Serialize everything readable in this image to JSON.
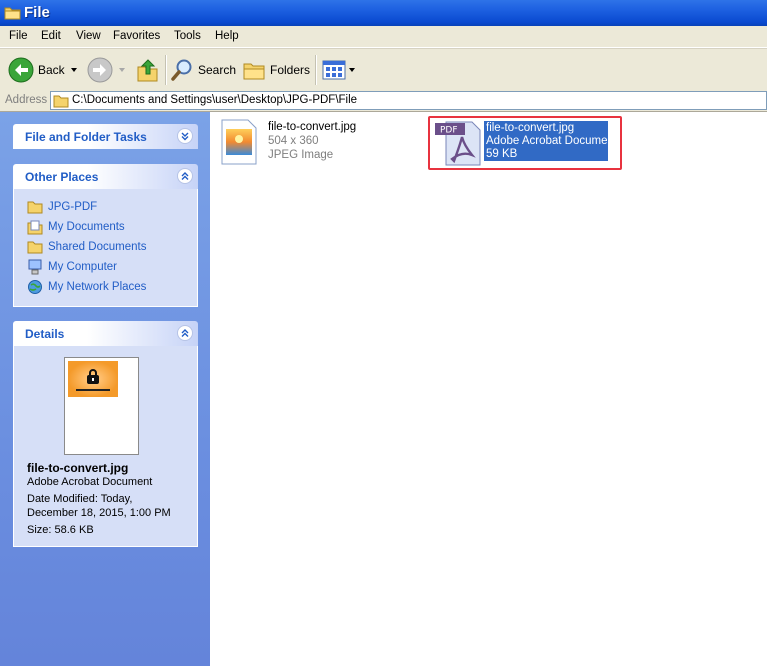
{
  "window": {
    "title": "File"
  },
  "menu": {
    "items": [
      "File",
      "Edit",
      "View",
      "Favorites",
      "Tools",
      "Help"
    ]
  },
  "toolbar": {
    "back_label": "Back",
    "search_label": "Search",
    "folders_label": "Folders"
  },
  "address": {
    "label": "Address",
    "path": "C:\\Documents and Settings\\user\\Desktop\\JPG-PDF\\File"
  },
  "sidebar": {
    "file_tasks": {
      "title": "File and Folder Tasks"
    },
    "other_places": {
      "title": "Other Places",
      "items": [
        "JPG-PDF",
        "My Documents",
        "Shared Documents",
        "My Computer",
        "My Network Places"
      ]
    },
    "details": {
      "title": "Details",
      "filename": "file-to-convert.jpg",
      "type": "Adobe Acrobat Document",
      "modified_line1": "Date Modified: Today,",
      "modified_line2": "December 18, 2015, 1:00 PM",
      "size": "Size: 58.6 KB"
    }
  },
  "files": [
    {
      "name": "file-to-convert.jpg",
      "line2": "504 x 360",
      "line3": "JPEG Image"
    },
    {
      "name": "file-to-convert.jpg",
      "line2": "Adobe Acrobat Document",
      "line3": "59 KB",
      "selected": true
    }
  ],
  "colors": {
    "selection": "#316ac5",
    "highlight_box": "#e8333f",
    "link": "#215dc6"
  }
}
